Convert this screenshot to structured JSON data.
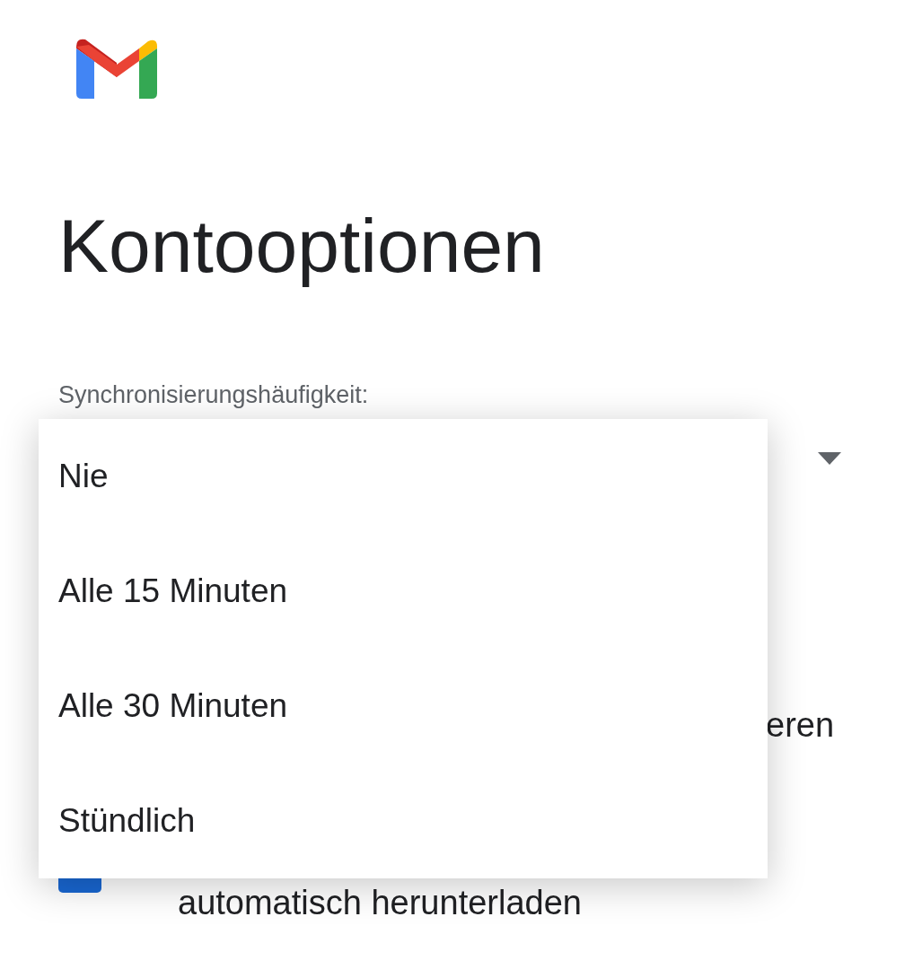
{
  "title": "Kontooptionen",
  "sync": {
    "label": "Synchronisierungshäufigkeit:",
    "expanded": true,
    "options": [
      {
        "label": "Nie"
      },
      {
        "label": "Alle 15 Minuten"
      },
      {
        "label": "Alle 30 Minuten"
      },
      {
        "label": "Stündlich"
      }
    ]
  },
  "hidden_setting": {
    "text_fragment": "eren"
  },
  "attachments": {
    "checked": true,
    "label": "automatisch herunterladen"
  }
}
